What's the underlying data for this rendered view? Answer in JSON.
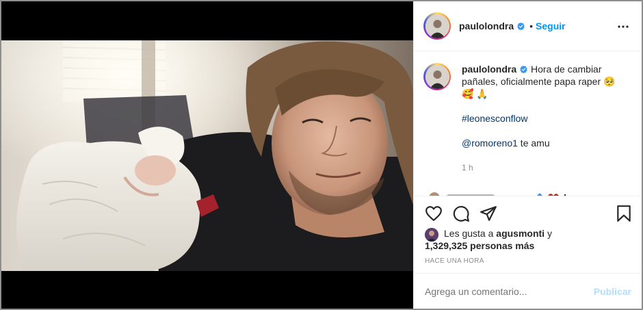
{
  "post": {
    "username": "paulolondra",
    "separator": "•",
    "follow_label": "Seguir",
    "caption": {
      "username": "paulolondra",
      "text": "Hora de cambiar pañales, oficialmente papa raper 🥺",
      "emoji_line": "🥰 🙏",
      "hashtag": "#leonesconflow",
      "mention": "@romoreno1",
      "mention_suffix": " te amu",
      "time": "1 h"
    },
    "likes": {
      "prefix": "Les gusta a ",
      "user": "agusmonti",
      "connector": " y",
      "count": "1,329,325 personas más"
    },
    "time_ago": "HACE UNA HORA",
    "comment": {
      "placeholder": "Agrega un comentario...",
      "publish_label": "Publicar"
    }
  },
  "icons": {
    "verified": "verified-badge-icon",
    "more": "more-options-icon",
    "like": "heart-icon",
    "comment": "comment-bubble-icon",
    "share": "paper-plane-icon",
    "save": "bookmark-icon"
  },
  "colors": {
    "accent": "#0095f6",
    "link": "#00376b",
    "muted": "#8e8e8e",
    "publish_disabled": "#b2dffc",
    "border": "#efefef"
  }
}
